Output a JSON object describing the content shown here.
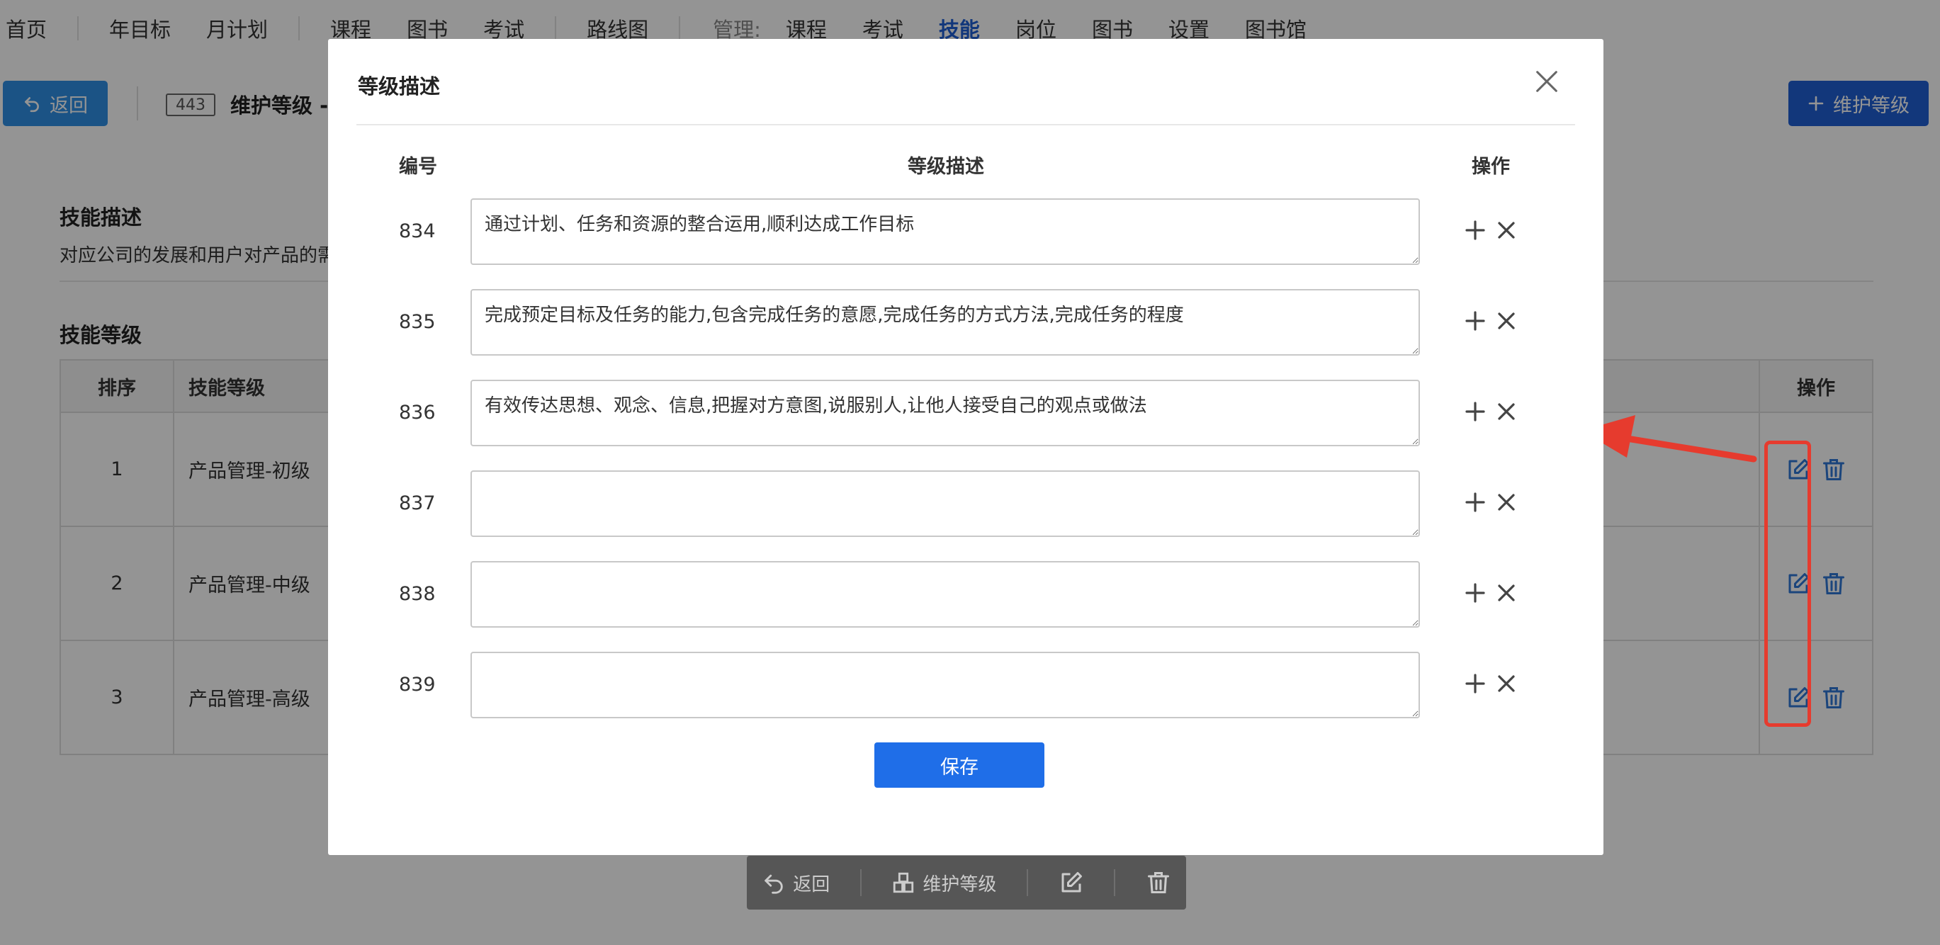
{
  "nav": {
    "items": [
      "首页",
      "年目标",
      "月计划",
      "课程",
      "图书",
      "考试",
      "路线图"
    ],
    "manage_label": "管理:",
    "manage_items": [
      "课程",
      "考试",
      "技能",
      "岗位",
      "图书",
      "设置",
      "图书馆"
    ],
    "active": "技能"
  },
  "subbar": {
    "back_label": "返回",
    "id_badge": "443",
    "title": "维护等级 -",
    "maintain_label": "维护等级"
  },
  "skill": {
    "desc_heading": "技能描述",
    "desc_text": "对应公司的发展和用户对产品的需",
    "levels_heading": "技能等级",
    "table": {
      "headers": {
        "order": "排序",
        "level": "技能等级",
        "ops": "操作"
      },
      "rows": [
        {
          "order": "1",
          "level": "产品管理-初级"
        },
        {
          "order": "2",
          "level": "产品管理-中级"
        },
        {
          "order": "3",
          "level": "产品管理-高级"
        }
      ]
    }
  },
  "bottom_toolbar": {
    "back_label": "返回",
    "maintain_label": "维护等级"
  },
  "modal": {
    "title": "等级描述",
    "col_id": "编号",
    "col_desc": "等级描述",
    "col_ops": "操作",
    "rows": [
      {
        "id": "834",
        "text": "通过计划、任务和资源的整合运用,顺利达成工作目标"
      },
      {
        "id": "835",
        "text": "完成预定目标及任务的能力,包含完成任务的意愿,完成任务的方式方法,完成任务的程度"
      },
      {
        "id": "836",
        "text": "有效传达思想、观念、信息,把握对方意图,说服别人,让他人接受自己的观点或做法"
      },
      {
        "id": "837",
        "text": ""
      },
      {
        "id": "838",
        "text": ""
      },
      {
        "id": "839",
        "text": ""
      }
    ],
    "save_label": "保存"
  },
  "colors": {
    "primary": "#1f6ee8",
    "back_button": "#2f8fe6",
    "annotation": "#e63b2e"
  },
  "icons": [
    "back-arrow-icon",
    "plus-icon",
    "edit-icon",
    "trash-icon",
    "close-icon",
    "grid-icon"
  ]
}
